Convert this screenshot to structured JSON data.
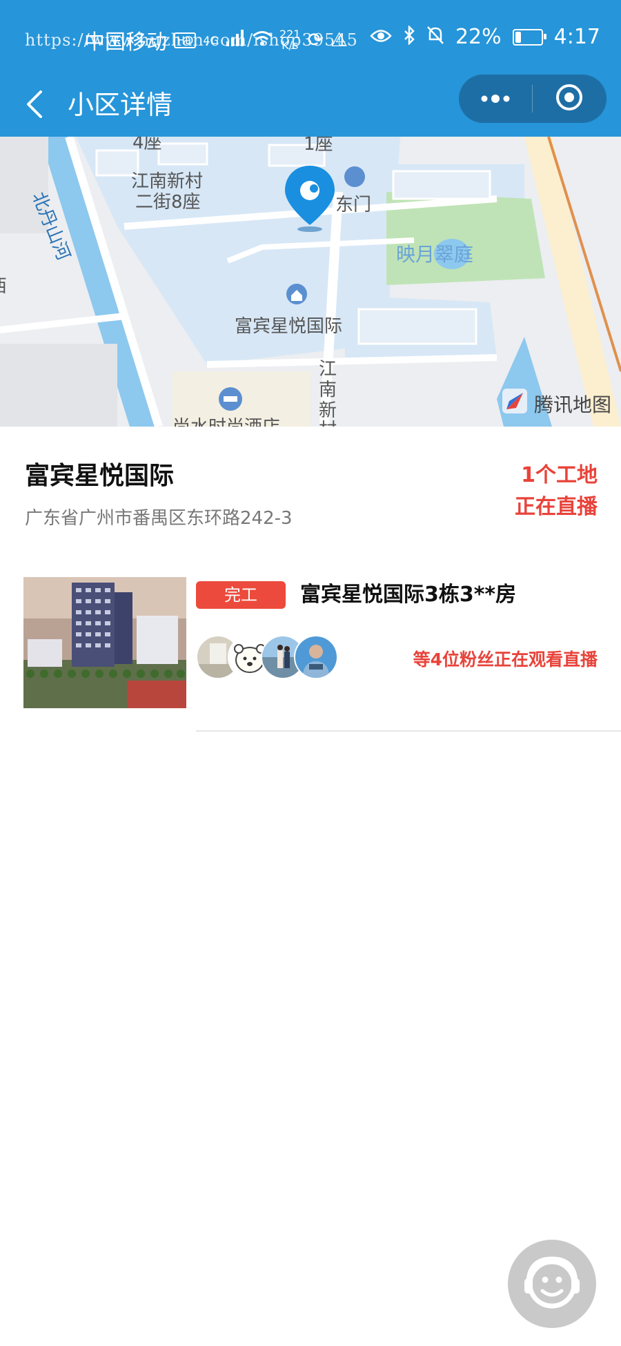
{
  "status_bar": {
    "carrier": "中国移动",
    "network_badge": "HD",
    "network_type": "4G",
    "speed_value": "221",
    "speed_unit": "K/s",
    "battery": "22%",
    "battery_level": 0.22,
    "time": "4:17",
    "watermark": "https://www.huzhan.com/ishop39545"
  },
  "nav": {
    "title": "小区详情",
    "back_icon": "chevron-left-icon",
    "more_icon": "more-dots-icon",
    "close_icon": "target-circle-icon"
  },
  "map": {
    "labels": {
      "building_4": "4座",
      "building_1": "1座",
      "village": "江南新村",
      "street": "二街8座",
      "east_gate": "东门",
      "garden": "映月翠庭",
      "river": "北丹山河",
      "target_name": "富宾星悦国际",
      "road": "江南新",
      "road2": "村",
      "hotel": "尚水时尚酒店",
      "edge": "西"
    },
    "attribution": "腾讯地图",
    "colors": {
      "water": "#8dc8ee",
      "block": "#d6e6f5",
      "green": "#bfe3b6",
      "road": "#ffffff",
      "pin": "#1a8fe0"
    }
  },
  "community": {
    "name": "富宾星悦国际",
    "address": "广东省广州市番禺区东环路242-3",
    "live_line1": "1个工地",
    "live_line2": "正在直播"
  },
  "listing": {
    "status": "完工",
    "title": "富宾星悦国际3栋3**房",
    "viewers_text": "等4位粉丝正在观看直播",
    "avatar_count": 4
  },
  "service": {
    "icon": "customer-service-icon"
  }
}
